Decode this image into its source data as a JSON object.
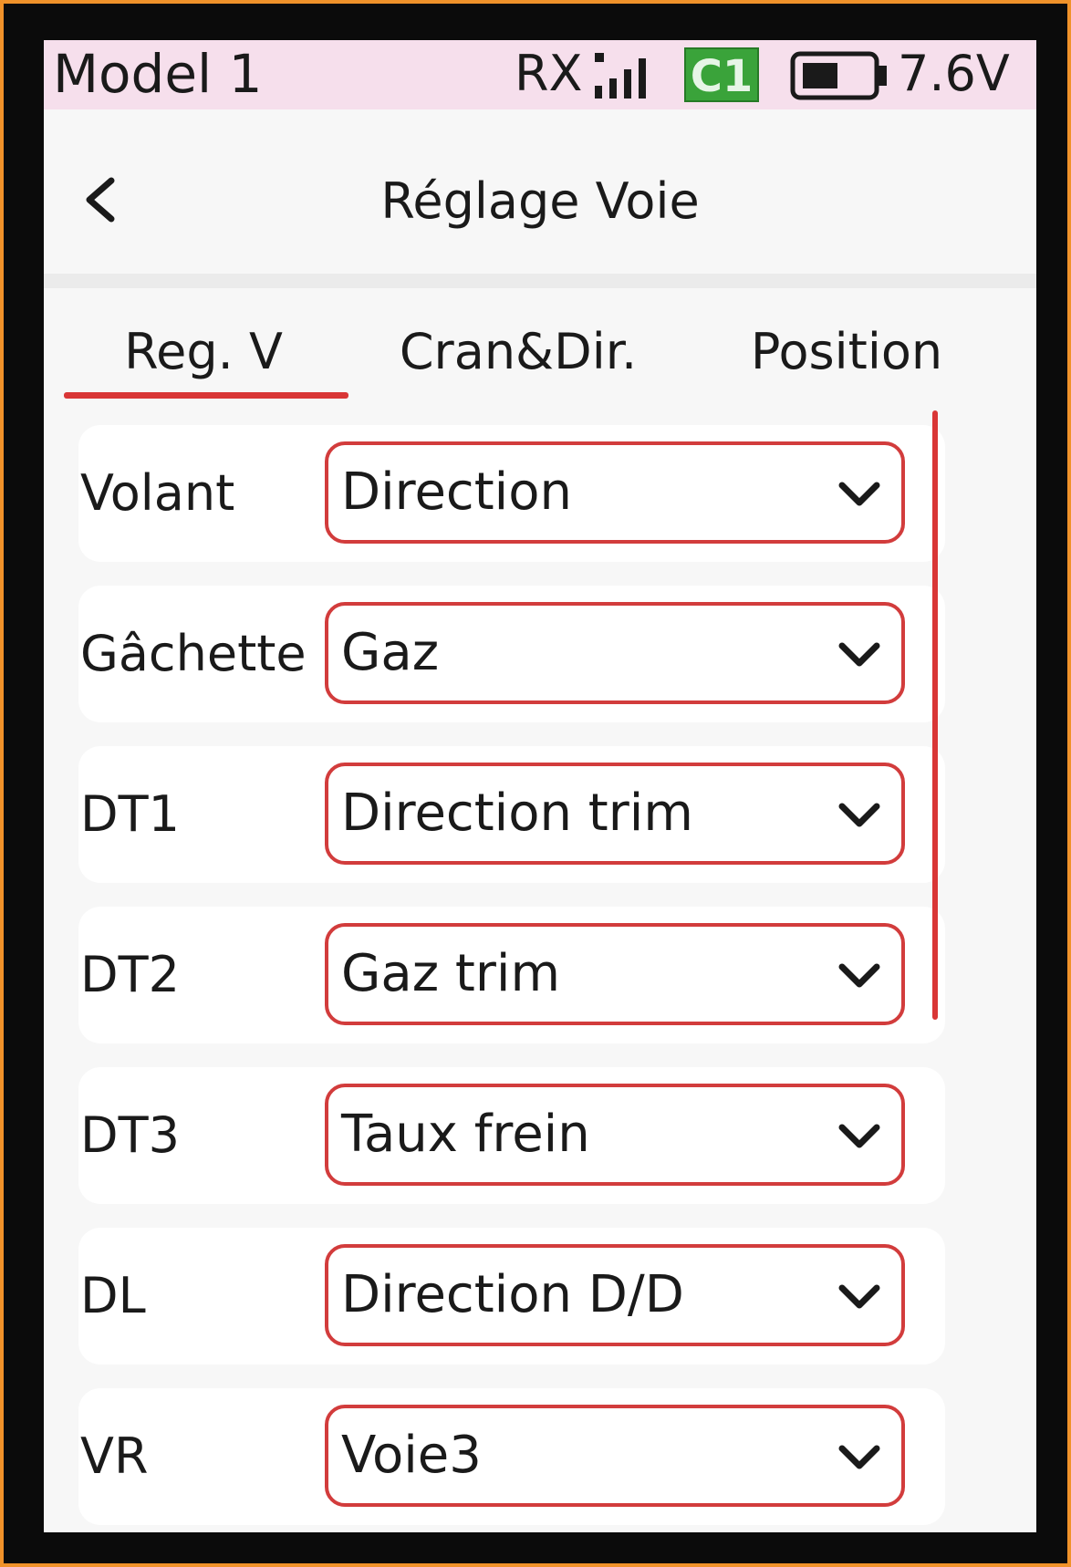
{
  "status_bar": {
    "model_name": "Model 1",
    "rx_label": "RX",
    "channel_badge": "C1",
    "voltage": "7.6V",
    "icons": [
      "signal-bars-icon",
      "battery-icon"
    ]
  },
  "header": {
    "title": "Réglage Voie",
    "back_icon": "chevron-left-icon"
  },
  "tabs": [
    {
      "label": "Reg. V",
      "active": true
    },
    {
      "label": "Cran&Dir.",
      "active": false
    },
    {
      "label": "Position",
      "active": false
    }
  ],
  "rows": [
    {
      "label": "Volant",
      "value": "Direction"
    },
    {
      "label": "Gâchette",
      "value": "Gaz"
    },
    {
      "label": "DT1",
      "value": "Direction trim"
    },
    {
      "label": "DT2",
      "value": "Gaz trim"
    },
    {
      "label": "DT3",
      "value": "Taux frein"
    },
    {
      "label": "DL",
      "value": "Direction D/D"
    },
    {
      "label": "VR",
      "value": "Voie3"
    }
  ],
  "colors": {
    "accent": "#d93636",
    "status_bar_bg": "#f6dfec",
    "channel_badge_bg": "#3aa33a",
    "frame_border": "#f0922a"
  }
}
